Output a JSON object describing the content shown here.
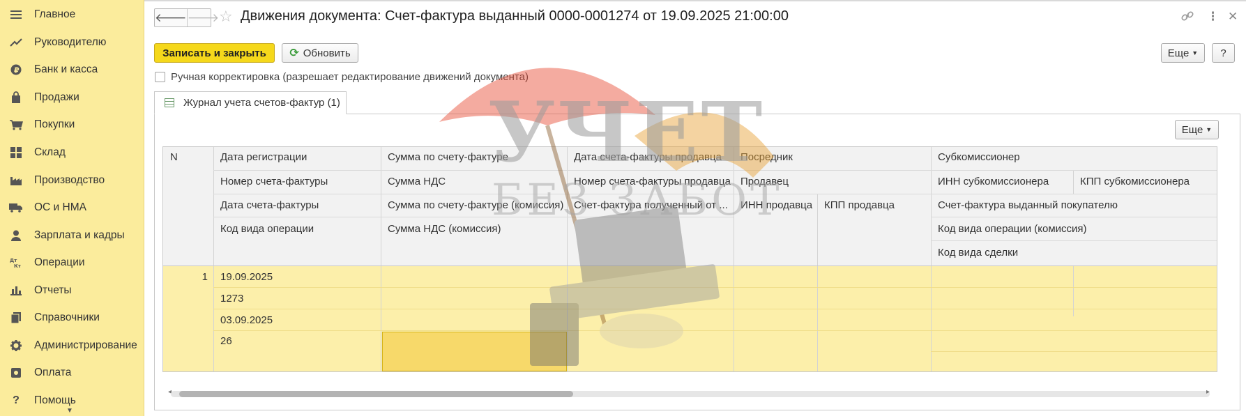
{
  "sidebar": {
    "items": [
      {
        "label": "Главное",
        "icon": "menu-icon"
      },
      {
        "label": "Руководителю",
        "icon": "trend-icon"
      },
      {
        "label": "Банк и касса",
        "icon": "ruble-icon"
      },
      {
        "label": "Продажи",
        "icon": "bag-icon"
      },
      {
        "label": "Покупки",
        "icon": "cart-icon"
      },
      {
        "label": "Склад",
        "icon": "grid-icon"
      },
      {
        "label": "Производство",
        "icon": "factory-icon"
      },
      {
        "label": "ОС и НМА",
        "icon": "truck-icon"
      },
      {
        "label": "Зарплата и кадры",
        "icon": "person-icon"
      },
      {
        "label": "Операции",
        "icon": "dt-kt-icon"
      },
      {
        "label": "Отчеты",
        "icon": "bar-chart-icon"
      },
      {
        "label": "Справочники",
        "icon": "books-icon"
      },
      {
        "label": "Администрирование",
        "icon": "gear-icon"
      },
      {
        "label": "Оплата",
        "icon": "payment-icon"
      },
      {
        "label": "Помощь",
        "icon": "question-icon"
      }
    ]
  },
  "header": {
    "back": "🡐",
    "forward": "🡒",
    "title": "Движения документа: Счет-фактура выданный 0000-0001274 от 19.09.2025 21:00:00",
    "link_glyph": "🔗",
    "more_glyph": "⋮",
    "close_glyph": "✕"
  },
  "toolbar": {
    "save_close": "Записать и закрыть",
    "refresh": "Обновить",
    "more": "Еще",
    "help": "?"
  },
  "manual_edit": {
    "checked": false,
    "label": "Ручная корректировка (разрешает редактирование движений документа)"
  },
  "tab": {
    "label": "Журнал учета счетов-фактур (1)"
  },
  "table": {
    "more": "Еще",
    "headers": {
      "n": "N",
      "c1": [
        "Дата регистрации",
        "Номер счета-фактуры",
        "Дата счета-фактуры",
        "Код вида операции"
      ],
      "c2": [
        "Сумма по счету-фактуре",
        "Сумма НДС",
        "Сумма по счету-фактуре (комиссия)",
        "Сумма НДС (комиссия)"
      ],
      "c3": [
        "Дата счета-фактуры продавца",
        "Номер счета-фактуры продавца",
        "Счет-фактура полученный от ..."
      ],
      "c4": [
        "Посредник",
        "Продавец",
        "ИНН продавца",
        "КПП продавца"
      ],
      "c5": [
        "Субкомиссионер",
        "ИНН субкомиссионера",
        "КПП субкомиссионера",
        "Счет-фактура выданный покупателю",
        "Код вида операции (комиссия)",
        "Код вида сделки"
      ]
    },
    "row": {
      "n": "1",
      "c1": [
        "19.09.2025",
        "1273",
        "03.09.2025",
        "26"
      ]
    }
  },
  "watermark": {
    "line1": "УЧЕТ",
    "line2": "БЕЗ ЗАБОТ"
  },
  "colors": {
    "sidebar": "#fbec9c",
    "primary_button": "#f5d81b",
    "row_highlight": "#fcefaa"
  }
}
